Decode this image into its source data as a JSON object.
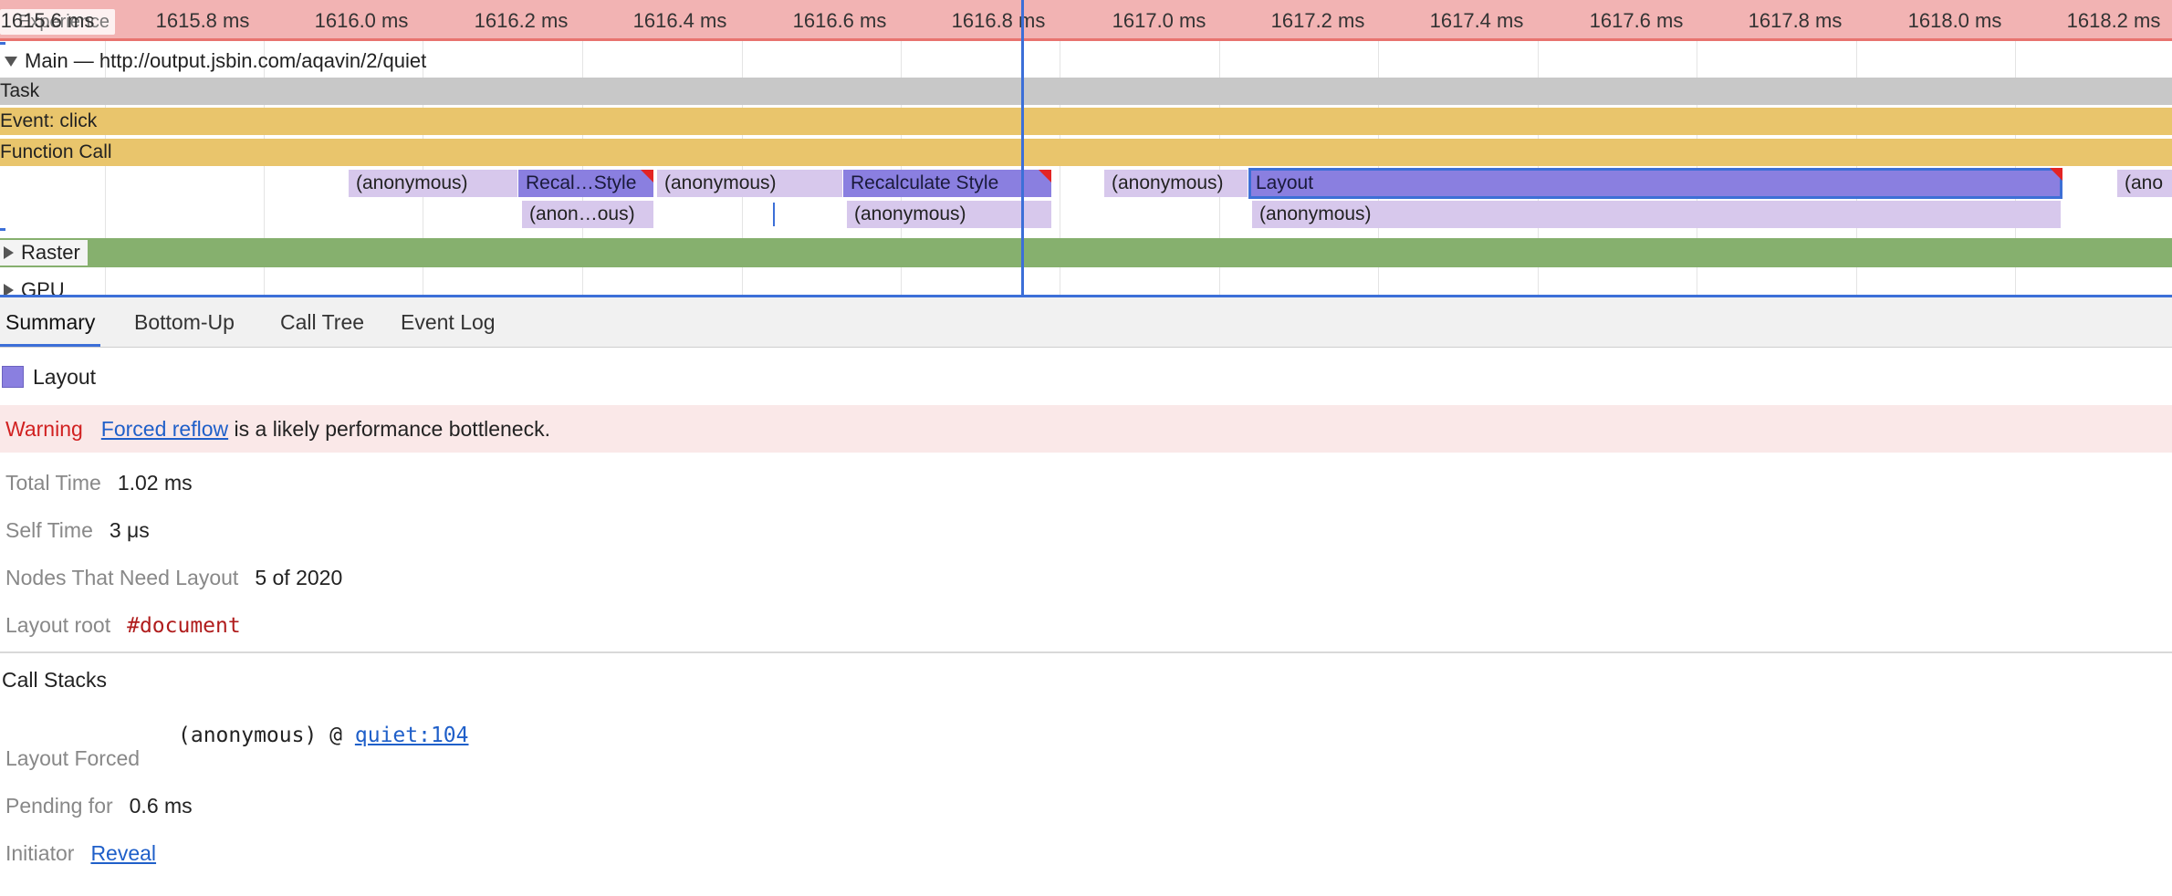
{
  "ruler": {
    "experience_label": "Experience",
    "ticks": [
      "1615.6 ms",
      "1615.8 ms",
      "1616.0 ms",
      "1616.2 ms",
      "1616.4 ms",
      "1616.6 ms",
      "1616.8 ms",
      "1617.0 ms",
      "1617.2 ms",
      "1617.4 ms",
      "1617.6 ms",
      "1617.8 ms",
      "1618.0 ms",
      "1618.2 ms"
    ]
  },
  "tracks": {
    "main_header": "Main — http://output.jsbin.com/aqavin/2/quiet",
    "task": "Task",
    "event": "Event: click",
    "function_call": "Function Call",
    "level4": [
      {
        "label": "(anonymous)",
        "kind": "anon"
      },
      {
        "label": "Recal…Style",
        "kind": "purple"
      },
      {
        "label": "(anonymous)",
        "kind": "anon"
      },
      {
        "label": "Recalculate Style",
        "kind": "purple"
      },
      {
        "label": "(anonymous)",
        "kind": "anon"
      },
      {
        "label": "Layout",
        "kind": "purple"
      },
      {
        "label": "(ano",
        "kind": "anon"
      }
    ],
    "level5": [
      {
        "label": "(anon…ous)"
      },
      {
        "label": "(anonymous)"
      },
      {
        "label": "(anonymous)"
      }
    ],
    "raster": "Raster",
    "gpu": "GPU"
  },
  "tabs": [
    "Summary",
    "Bottom-Up",
    "Call Tree",
    "Event Log"
  ],
  "summary": {
    "title": "Layout",
    "warning_label": "Warning",
    "warning_link": "Forced reflow",
    "warning_text": " is a likely performance bottleneck.",
    "total_time_label": "Total Time",
    "total_time": "1.02 ms",
    "self_time_label": "Self Time",
    "self_time": "3 μs",
    "nodes_label": "Nodes That Need Layout",
    "nodes_value": "5 of 2020",
    "layout_root_label": "Layout root",
    "layout_root_value": "#document",
    "call_stacks_title": "Call Stacks",
    "layout_forced_label": "Layout Forced",
    "stack_function": "(anonymous) @ ",
    "stack_link": "quiet:104",
    "pending_label": "Pending for",
    "pending_value": "0.6 ms",
    "initiator_label": "Initiator",
    "initiator_link": "Reveal"
  },
  "colors": {
    "ruler_bg": "#f2b3b3",
    "task": "#c8c8c8",
    "event": "#e9c56c",
    "anonymous": "#d7c8ec",
    "layout": "#8a7fe0",
    "raster": "#86b06e",
    "selection": "#3c6fd8",
    "warning": "#d12121"
  }
}
